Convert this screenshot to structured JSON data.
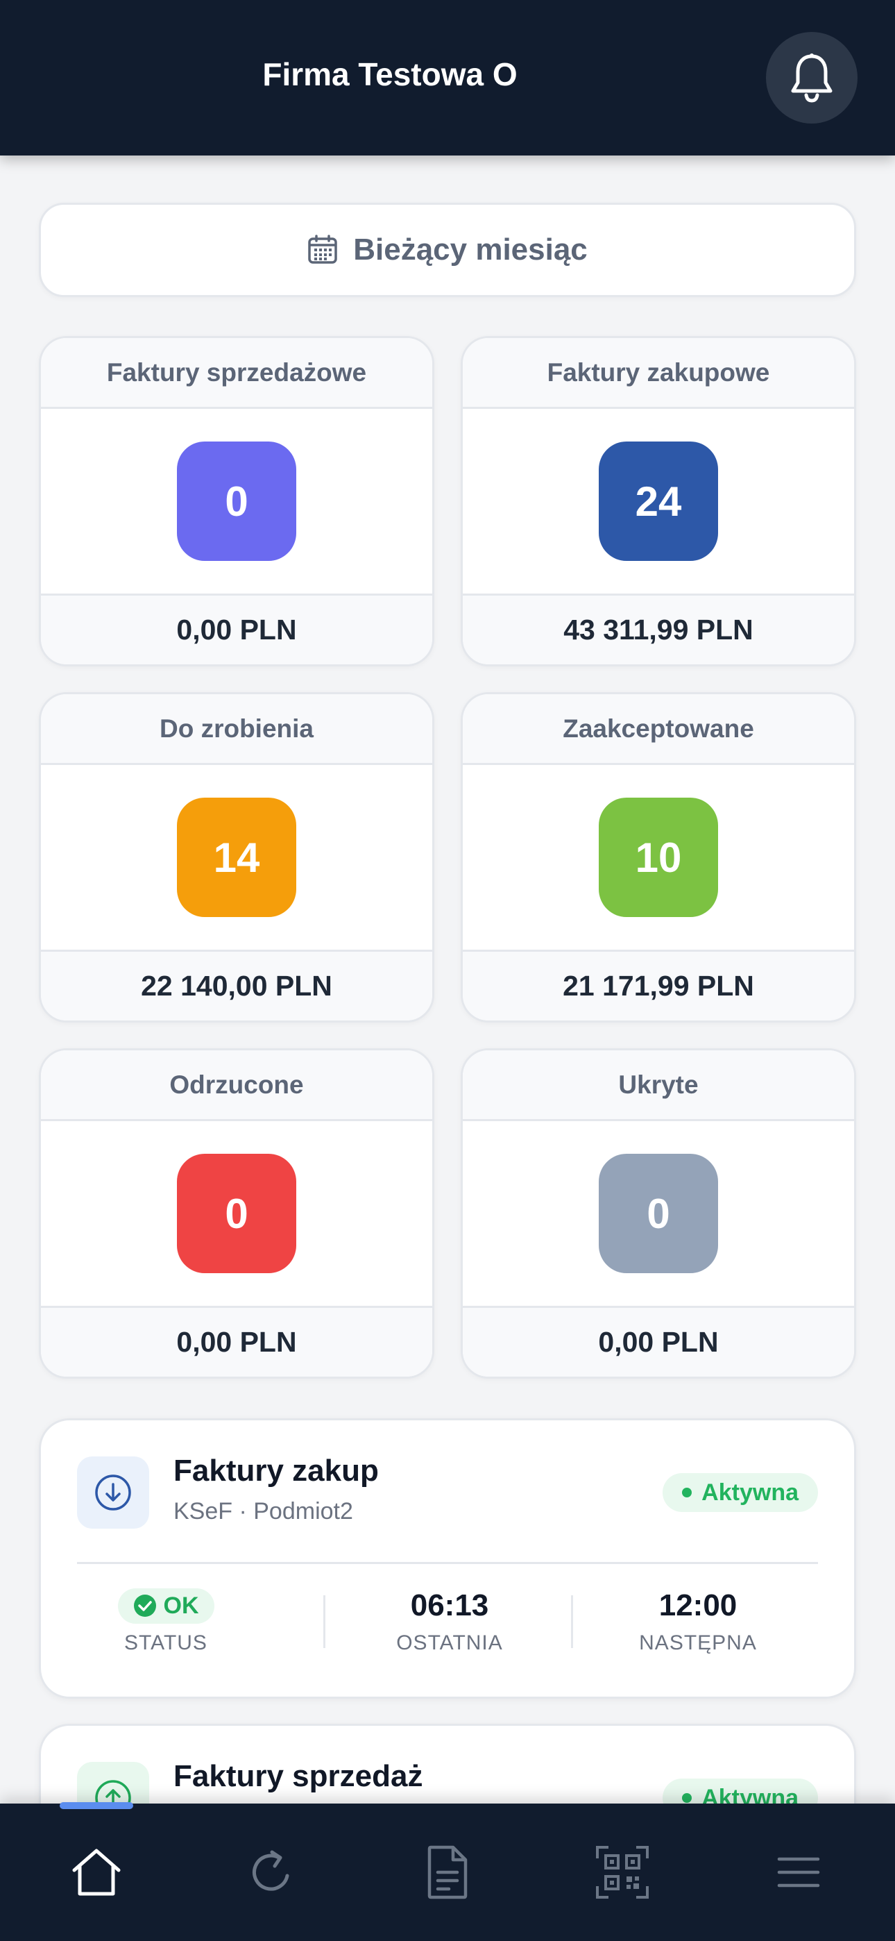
{
  "header": {
    "title": "Firma Testowa O"
  },
  "period_button": {
    "label": "Bieżący miesiąc"
  },
  "stats": [
    {
      "title": "Faktury sprzedażowe",
      "count": "0",
      "amount": "0,00 PLN",
      "color": "#6b6af0"
    },
    {
      "title": "Faktury zakupowe",
      "count": "24",
      "amount": "43 311,99 PLN",
      "color": "#2d58a8"
    },
    {
      "title": "Do zrobienia",
      "count": "14",
      "amount": "22 140,00 PLN",
      "color": "#f59e0b"
    },
    {
      "title": "Zaakceptowane",
      "count": "10",
      "amount": "21 171,99 PLN",
      "color": "#7cc242"
    },
    {
      "title": "Odrzucone",
      "count": "0",
      "amount": "0,00 PLN",
      "color": "#ef4444"
    },
    {
      "title": "Ukryte",
      "count": "0",
      "amount": "0,00 PLN",
      "color": "#94a3b8"
    }
  ],
  "sync_cards": [
    {
      "title": "Faktury zakup",
      "subtitle": "KSeF · Podmiot2",
      "badge": "Aktywna",
      "status_value": "OK",
      "status_label": "STATUS",
      "last_value": "06:13",
      "last_label": "OSTATNIA",
      "next_value": "12:00",
      "next_label": "NASTĘPNA"
    },
    {
      "title": "Faktury sprzedaż",
      "badge": "Aktywna"
    }
  ],
  "nav": {
    "items": [
      "home-icon",
      "refresh-icon",
      "document-icon",
      "qr-code-icon",
      "menu-icon"
    ],
    "active": "home-icon"
  }
}
